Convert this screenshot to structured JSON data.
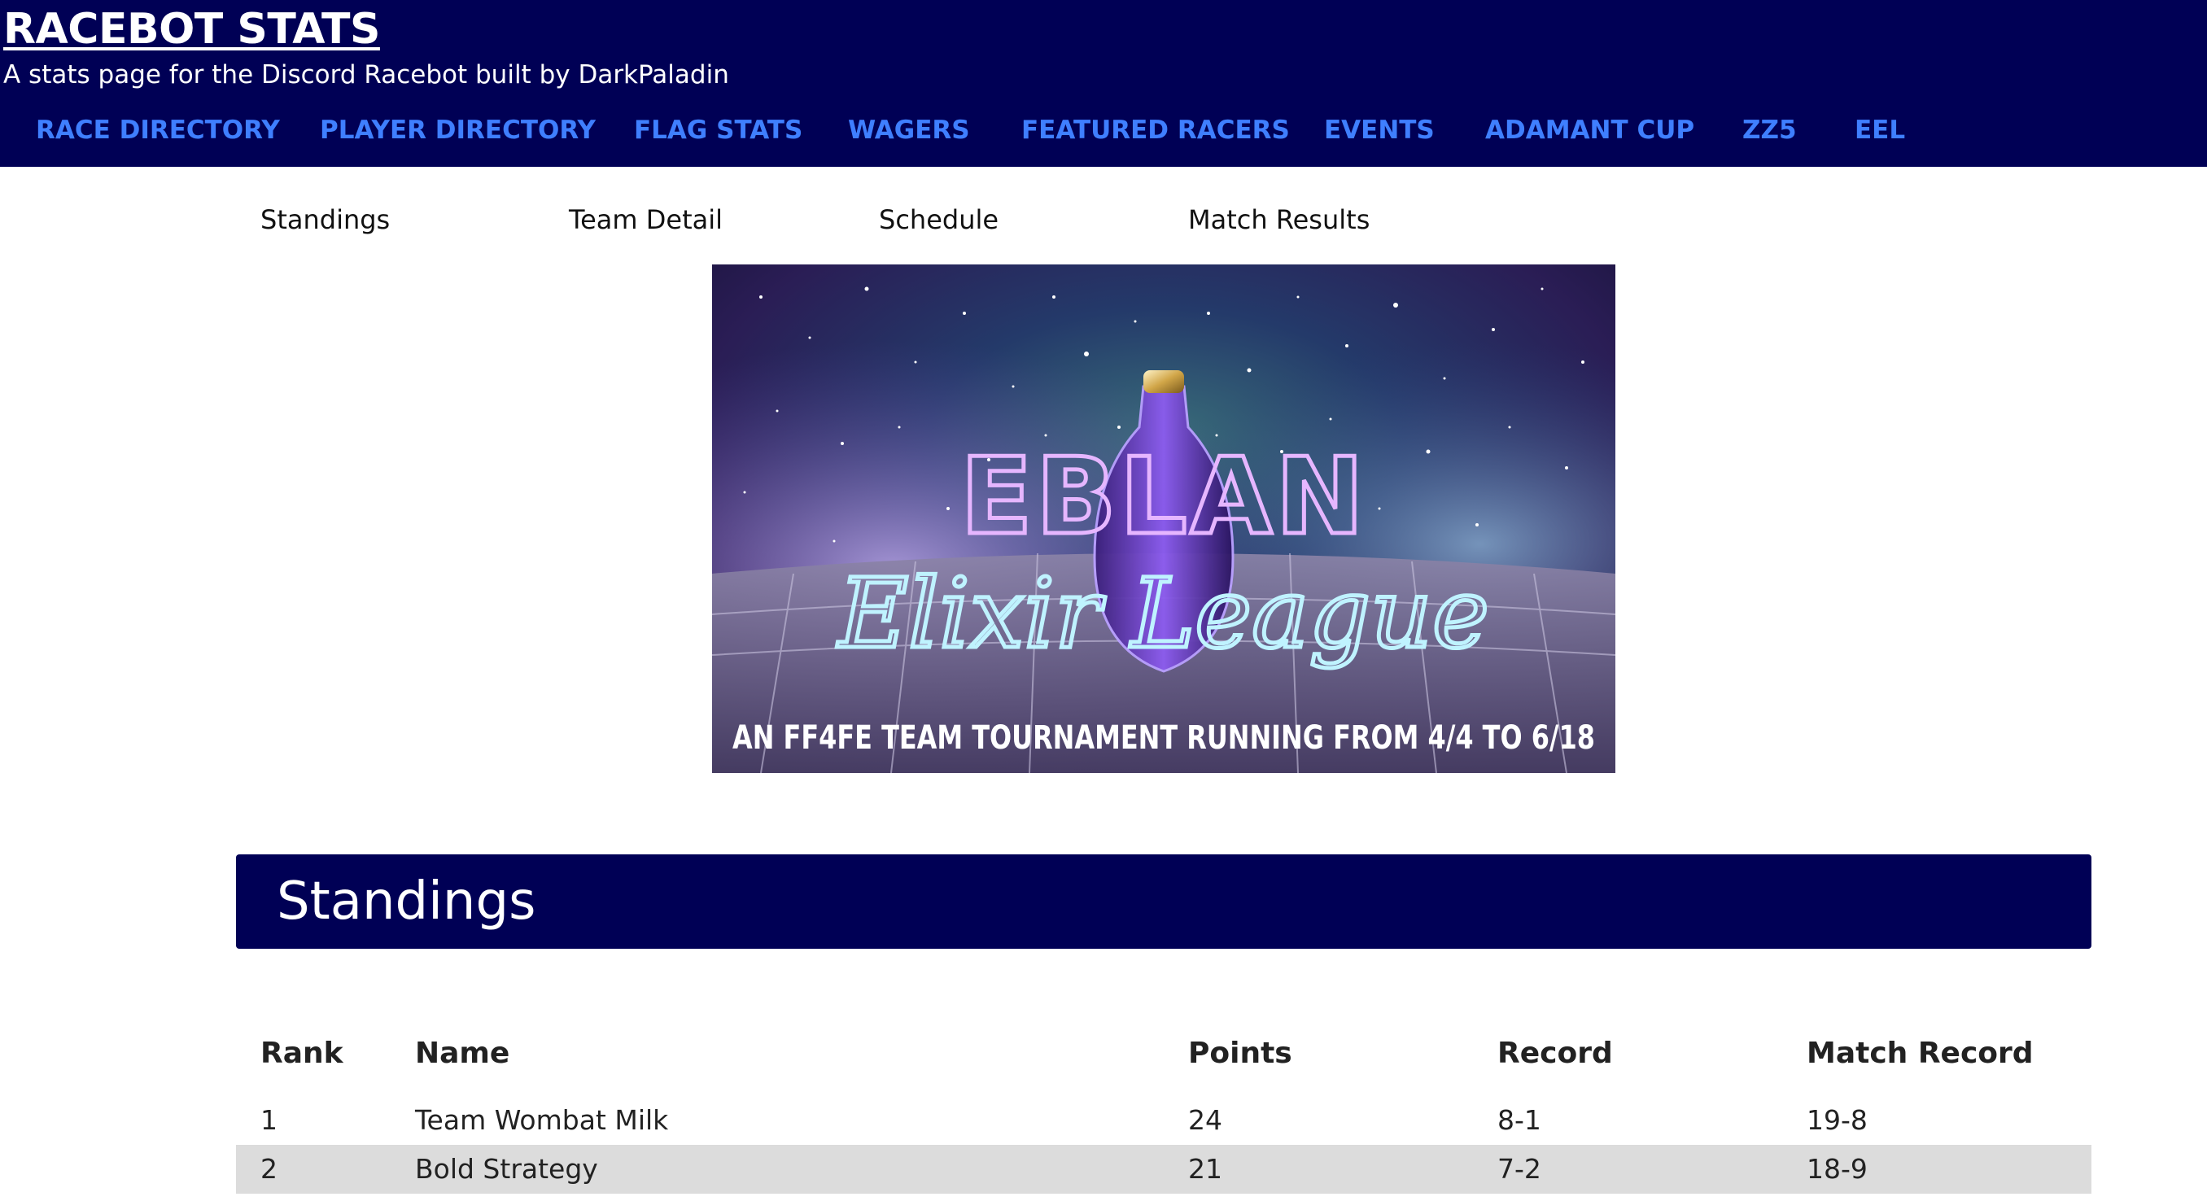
{
  "header": {
    "title": "RACEBOT STATS",
    "subtitle": "A stats page for the Discord Racebot built by DarkPaladin",
    "background_color": "#000055",
    "link_color": "#3f7fff",
    "nav": [
      "RACE DIRECTORY",
      "PLAYER DIRECTORY",
      "FLAG STATS",
      "WAGERS",
      "FEATURED RACERS",
      "EVENTS",
      "ADAMANT CUP",
      "ZZ5",
      "EEL"
    ]
  },
  "subnav": [
    "Standings",
    "Team Detail",
    "Schedule",
    "Match Results"
  ],
  "banner": {
    "line1": "EBLAN",
    "line2": "Elixir League",
    "line3": "AN FF4FE TEAM TOURNAMENT RUNNING FROM 4/4 TO 6/18"
  },
  "standings": {
    "title": "Standings",
    "columns": [
      "Rank",
      "Name",
      "Points",
      "Record",
      "Match Record"
    ],
    "rows": [
      [
        "1",
        "Team Wombat Milk",
        "24",
        "8-1",
        "19-8"
      ],
      [
        "2",
        "Bold Strategy",
        "21",
        "7-2",
        "18-9"
      ]
    ]
  }
}
